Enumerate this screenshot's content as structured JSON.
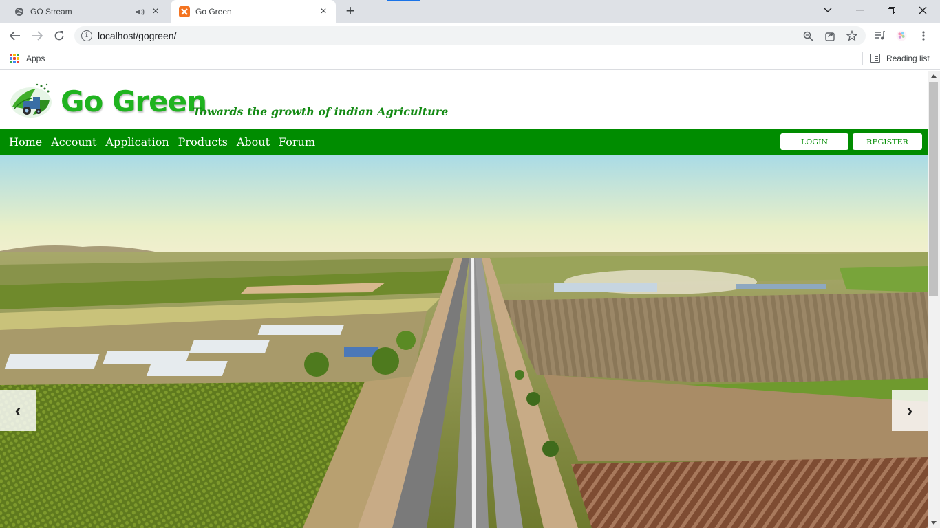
{
  "browser": {
    "tabs": [
      {
        "title": "GO Stream",
        "favicon": "globe-icon",
        "audio": true
      },
      {
        "title": "Go Green",
        "favicon": "xampp-icon",
        "active": true
      }
    ],
    "url": "localhost/gogreen/",
    "bookmarks": {
      "apps_label": "Apps",
      "reading_list_label": "Reading list"
    }
  },
  "site": {
    "brand": "Go Green",
    "tagline": "Towards the growth of indian Agriculture",
    "nav": [
      "Home",
      "Account",
      "Application",
      "Products",
      "About",
      "Forum"
    ],
    "login_label": "LOGIN",
    "register_label": "REGISTER",
    "colors": {
      "nav_bg": "#008c00",
      "brand_green": "#1fb31f"
    }
  },
  "carousel": {
    "prev_icon": "‹",
    "next_icon": "›",
    "image": "aerial-farmland-highway"
  }
}
